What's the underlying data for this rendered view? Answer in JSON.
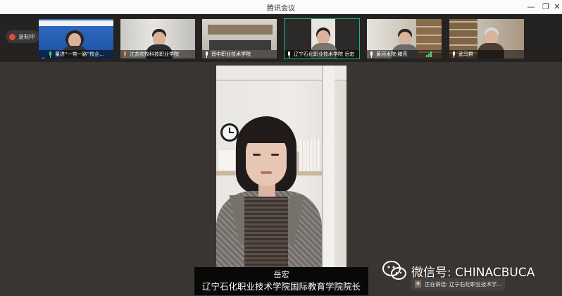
{
  "window": {
    "title": "腾讯会议",
    "minimize_icon": "minimize-icon",
    "maximize_icon": "restore-icon",
    "close_icon": "close-icon"
  },
  "toolbar": {
    "record_label": "录制中"
  },
  "participants": [
    {
      "name": "董进“一带一路”校企...",
      "mic": "on"
    },
    {
      "name": "江苏农牧科技职业学院",
      "mic": "on"
    },
    {
      "name": "晋中职业技术学院",
      "mic": "on"
    },
    {
      "name": "辽宁石化职业技术学院  岳宏",
      "mic": "on",
      "active": true
    },
    {
      "name": "黄河水院-滕亮",
      "mic": "on",
      "speaking": true
    },
    {
      "name": "武马群",
      "mic": "on"
    }
  ],
  "main_speaker": {
    "name": "岳宏",
    "title": "辽宁石化职业技术学院国际教育学院院长"
  },
  "watermark": {
    "text": "微信号: CHINACBUCA"
  },
  "speaking_indicator": {
    "text": "正在讲话: 辽宁石化职业技术学..."
  },
  "colors": {
    "background": "#3a3532",
    "strip": "#252322",
    "active_border": "#18b77d",
    "record_dot": "#e24a3a",
    "mic_on": "#4ed67c"
  }
}
